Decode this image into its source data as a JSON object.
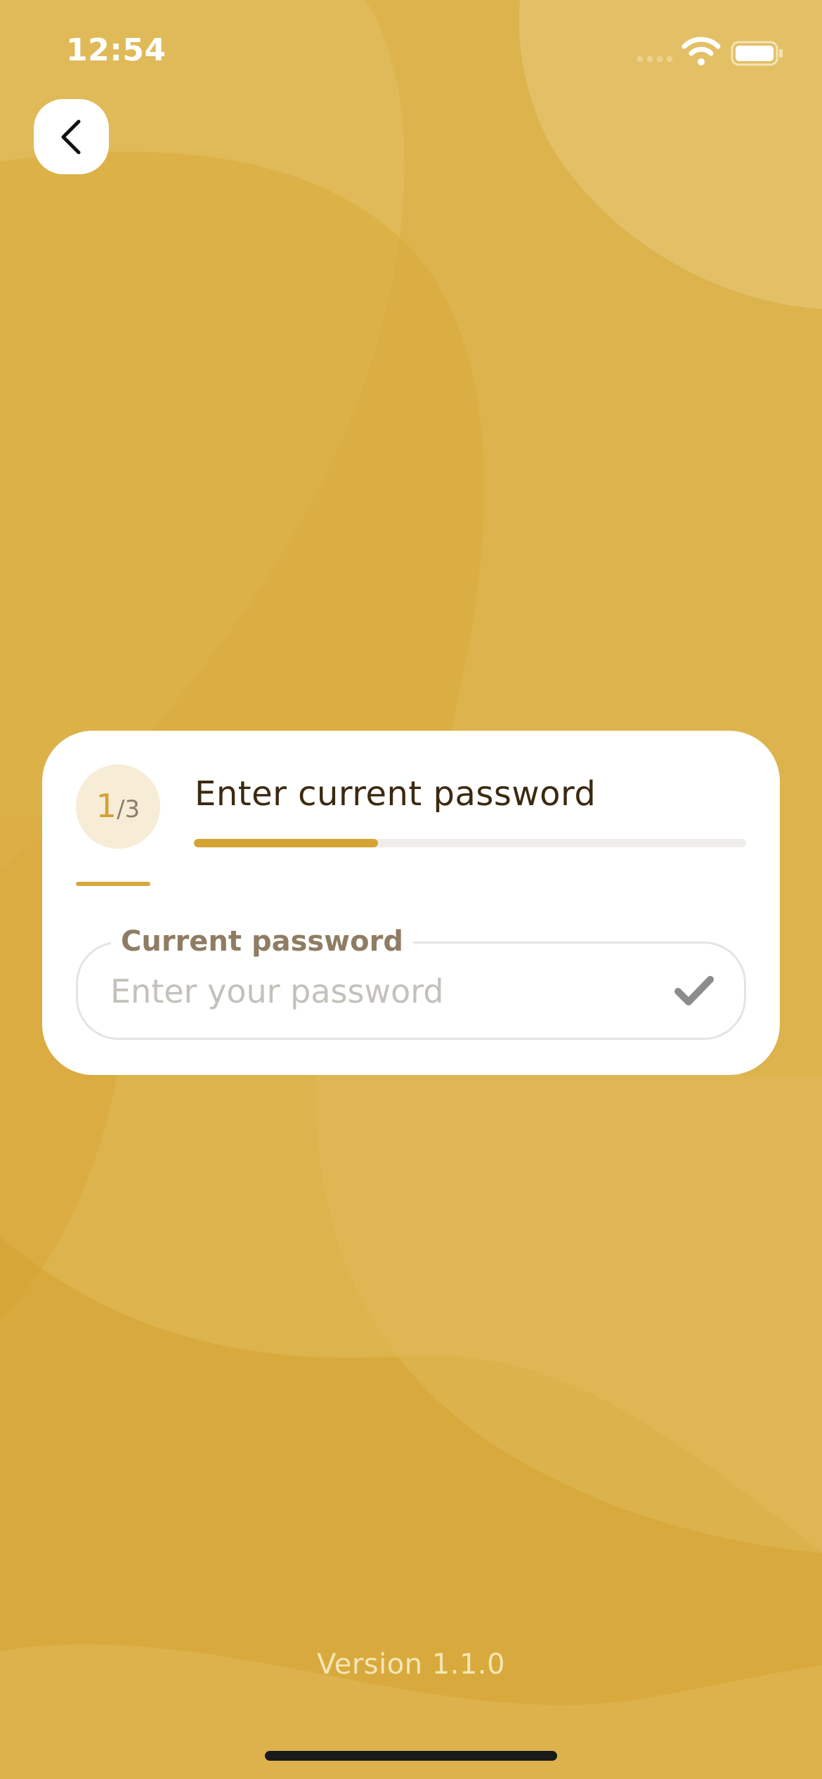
{
  "status_bar": {
    "time": "12:54",
    "signal_icon": "cellular-signal-icon",
    "wifi_icon": "wifi-icon",
    "battery_icon": "battery-icon"
  },
  "navigation": {
    "back_icon": "chevron-left-icon"
  },
  "step": {
    "current": "1",
    "separator": "/",
    "total": "3",
    "title": "Enter current password",
    "progress": 0.333
  },
  "password_field": {
    "label": "Current password",
    "placeholder": "Enter your password",
    "value": "",
    "validation_icon": "checkmark-icon"
  },
  "footer": {
    "version": "Version 1.1.0"
  },
  "colors": {
    "background": "#dcb34c",
    "accent": "#d4a433",
    "title_text": "#3b2a10",
    "label_text": "#8e7d63",
    "card": "#ffffff"
  }
}
